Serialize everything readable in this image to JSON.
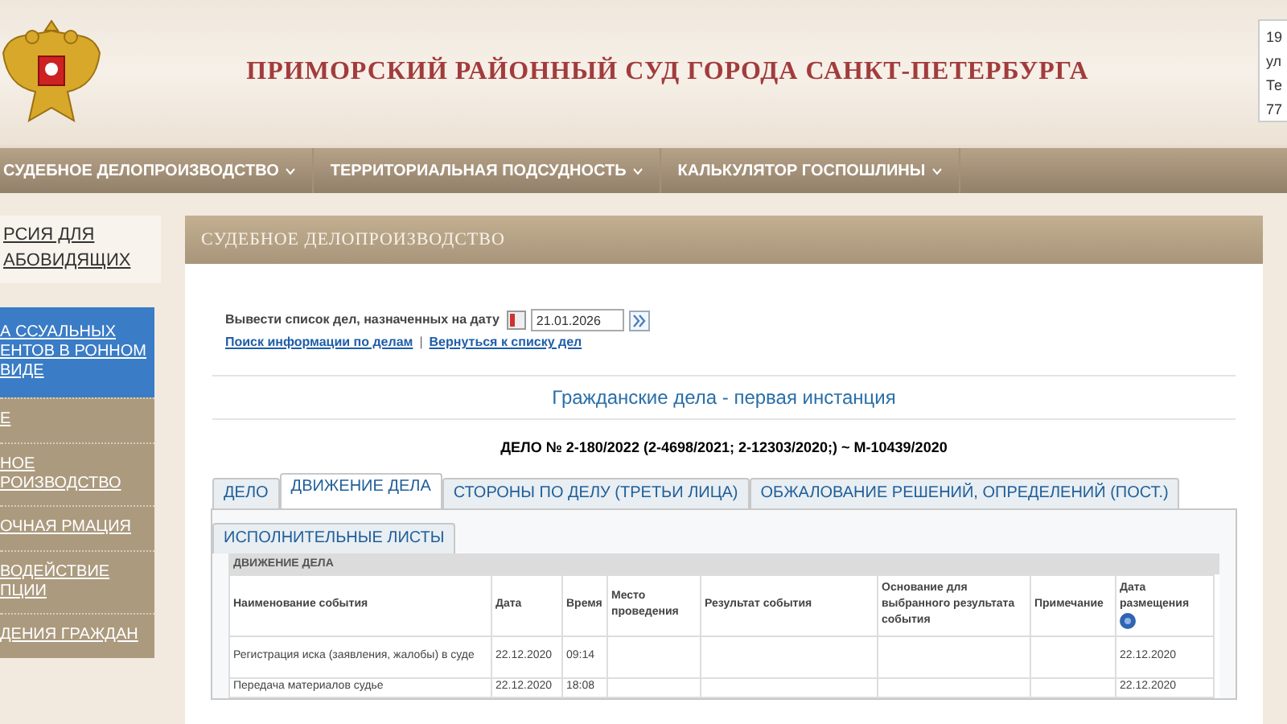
{
  "header": {
    "title": "ПРИМОРСКИЙ РАЙОННЫЙ СУД ГОРОДА САНКТ-ПЕТЕРБУРГА",
    "address_lines": [
      "19",
      "ул",
      "Те",
      "77"
    ]
  },
  "nav": [
    {
      "label": "СУДЕБНОЕ ДЕЛОПРОИЗВОДСТВО"
    },
    {
      "label": "ТЕРРИТОРИАЛЬНАЯ ПОДСУДНОСТЬ"
    },
    {
      "label": "КАЛЬКУЛЯТОР ГОСПОШЛИНЫ"
    }
  ],
  "sidebar": {
    "accessibility_link": "РСИЯ ДЛЯ АБОВИДЯЩИХ",
    "items": [
      {
        "label": "А ССУАЛЬНЫХ ЕНТОВ В РОННОМ ВИДЕ",
        "selected": true
      },
      {
        "label": "Е",
        "selected": false
      },
      {
        "label": "НОЕ РОИЗВОДСТВО",
        "selected": false
      },
      {
        "label": "ОЧНАЯ РМАЦИЯ",
        "selected": false
      },
      {
        "label": "ВОДЕЙСТВИЕ ПЦИИ",
        "selected": false
      },
      {
        "label": "ДЕНИЯ ГРАЖДАН",
        "selected": false
      }
    ]
  },
  "panel": {
    "title": "СУДЕБНОЕ ДЕЛОПРОИЗВОДСТВО",
    "date_filter": {
      "label": "Вывести список дел, назначенных на дату",
      "value": "21.01.2026"
    },
    "links": [
      "Поиск информации по делам",
      "Вернуться к списку дел"
    ],
    "links_separator": "|",
    "section_title": "Гражданские дела - первая инстанция",
    "case_number": "ДЕЛО № 2-180/2022 (2-4698/2021; 2-12303/2020;) ~ М-10439/2020",
    "tabs": [
      {
        "label": "ДЕЛО",
        "selected": false
      },
      {
        "label": "ДВИЖЕНИЕ ДЕЛА",
        "selected": true
      },
      {
        "label": "СТОРОНЫ ПО ДЕЛУ (ТРЕТЬИ ЛИЦА)",
        "selected": false
      },
      {
        "label": "ОБЖАЛОВАНИЕ РЕШЕНИЙ, ОПРЕДЕЛЕНИЙ (ПОСТ.)",
        "selected": false
      },
      {
        "label": "ИСПОЛНИТЕЛЬНЫЕ ЛИСТЫ",
        "selected": false
      }
    ],
    "table": {
      "caption": "ДВИЖЕНИЕ ДЕЛА",
      "columns": [
        "Наименование события",
        "Дата",
        "Время",
        "Место проведения",
        "Результат события",
        "Основание для выбранного результата события",
        "Примечание",
        "Дата размещения"
      ],
      "rows": [
        [
          "Регистрация иска (заявления, жалобы) в суде",
          "22.12.2020",
          "09:14",
          "",
          "",
          "",
          "",
          "22.12.2020"
        ],
        [
          "Передача материалов судье",
          "22.12.2020",
          "18:08",
          "",
          "",
          "",
          "",
          "22.12.2020"
        ]
      ]
    }
  }
}
